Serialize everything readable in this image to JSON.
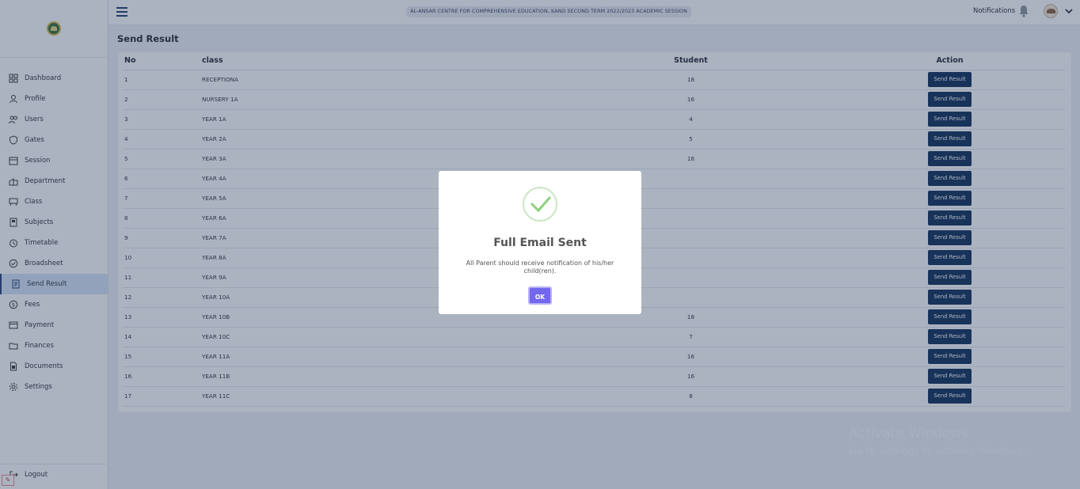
{
  "header": {
    "school_banner": "AL-ANSAR CENTRE FOR COMPREHENSIVE EDUCATION, KANO   SECOND TERM 2022/2023 ACADEMIC SESSION",
    "notifications_label": "Notifications"
  },
  "sidebar": {
    "items": [
      {
        "label": "Dashboard",
        "icon": "dashboard-icon"
      },
      {
        "label": "Profile",
        "icon": "profile-icon"
      },
      {
        "label": "Users",
        "icon": "users-icon"
      },
      {
        "label": "Gates",
        "icon": "shield-icon"
      },
      {
        "label": "Session",
        "icon": "calendar-icon"
      },
      {
        "label": "Department",
        "icon": "building-icon"
      },
      {
        "label": "Class",
        "icon": "chalkboard-icon"
      },
      {
        "label": "Subjects",
        "icon": "book-icon"
      },
      {
        "label": "Timetable",
        "icon": "clock-icon"
      },
      {
        "label": "Broadsheet",
        "icon": "check-circle-icon"
      },
      {
        "label": "Send Result",
        "icon": "document-icon",
        "active": true
      },
      {
        "label": "Fees",
        "icon": "dollar-icon"
      },
      {
        "label": "Payment",
        "icon": "card-icon"
      },
      {
        "label": "Finances",
        "icon": "folder-icon"
      },
      {
        "label": "Documents",
        "icon": "file-icon"
      },
      {
        "label": "Settings",
        "icon": "gear-icon"
      }
    ],
    "logout_label": "Logout"
  },
  "main": {
    "title": "Send Result",
    "columns": [
      "No",
      "class",
      "Student",
      "Action"
    ],
    "action_label": "Send Result",
    "rows": [
      {
        "no": "1",
        "class": "RECEPTIONA",
        "students": "18"
      },
      {
        "no": "2",
        "class": "NURSERY 1A",
        "students": "16"
      },
      {
        "no": "3",
        "class": "YEAR 1A",
        "students": "4"
      },
      {
        "no": "4",
        "class": "YEAR 2A",
        "students": "5"
      },
      {
        "no": "5",
        "class": "YEAR 3A",
        "students": "18"
      },
      {
        "no": "6",
        "class": "YEAR 4A",
        "students": ""
      },
      {
        "no": "7",
        "class": "YEAR 5A",
        "students": ""
      },
      {
        "no": "8",
        "class": "YEAR 6A",
        "students": ""
      },
      {
        "no": "9",
        "class": "YEAR 7A",
        "students": ""
      },
      {
        "no": "10",
        "class": "YEAR 8A",
        "students": ""
      },
      {
        "no": "11",
        "class": "YEAR 9A",
        "students": ""
      },
      {
        "no": "12",
        "class": "YEAR 10A",
        "students": ""
      },
      {
        "no": "13",
        "class": "YEAR 10B",
        "students": "18"
      },
      {
        "no": "14",
        "class": "YEAR 10C",
        "students": "7"
      },
      {
        "no": "15",
        "class": "YEAR 11A",
        "students": "16"
      },
      {
        "no": "16",
        "class": "YEAR 11B",
        "students": "16"
      },
      {
        "no": "17",
        "class": "YEAR 11C",
        "students": "8"
      }
    ]
  },
  "modal": {
    "title": "Full Email Sent",
    "text": "All Parent should receive notification of his/her child(ren).",
    "ok_label": "OK"
  },
  "watermark": {
    "title": "Activate Windows",
    "subtitle": "Go to Settings to activate Windows."
  },
  "colors": {
    "primary": "#0b2a55",
    "modal_button": "#7367f0",
    "success_check": "#8cd17d"
  }
}
